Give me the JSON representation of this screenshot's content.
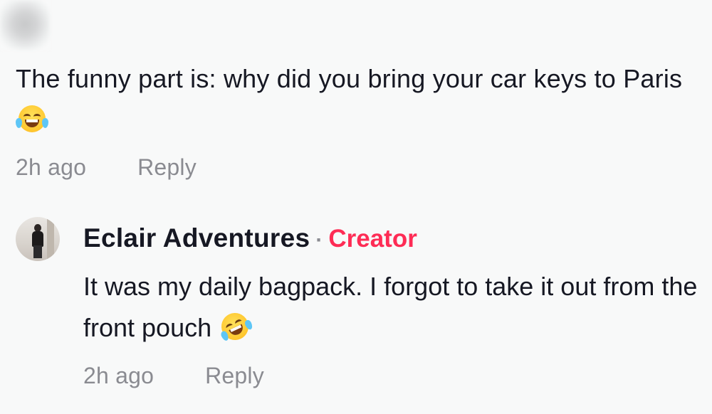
{
  "comment": {
    "text": "The funny part is: why did you bring your car keys to Paris",
    "emoji": "😂",
    "time": "2h ago",
    "reply_label": "Reply"
  },
  "reply": {
    "author": "Eclair Adventures",
    "separator": "·",
    "badge": "Creator",
    "text": "It was my daily bagpack. I forgot to take it out from the front pouch",
    "emoji": "🤣",
    "time": "2h ago",
    "reply_label": "Reply"
  },
  "colors": {
    "background": "#f8f9f9",
    "text": "#161823",
    "muted": "#8a8b91",
    "creator_badge": "#fe2c55"
  }
}
